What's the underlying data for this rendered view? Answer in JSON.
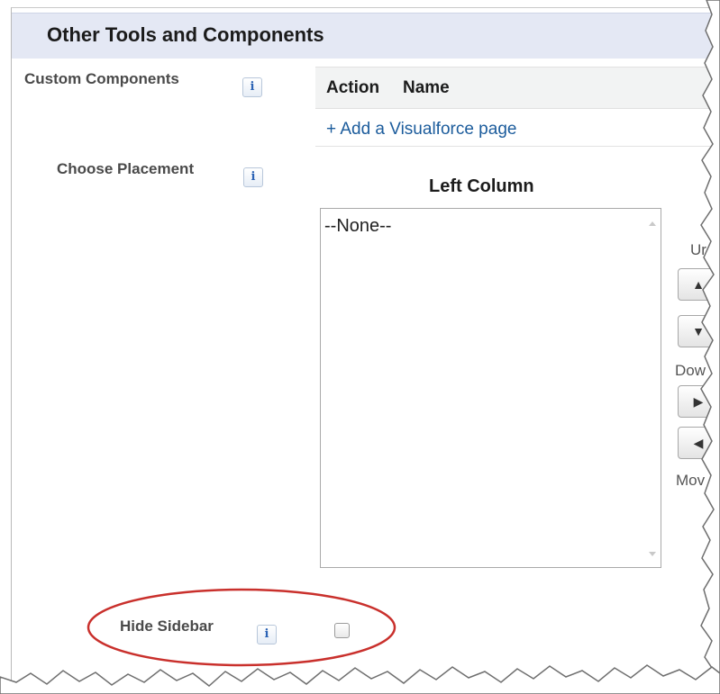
{
  "section": {
    "title": "Other Tools and Components"
  },
  "custom_components": {
    "label": "Custom Components",
    "info_icon": "i",
    "table": {
      "columns": [
        "Action",
        "Name"
      ],
      "add_link": "+ Add a Visualforce page"
    }
  },
  "choose_placement": {
    "label": "Choose Placement",
    "info_icon": "i",
    "left_column": {
      "caption": "Left Column",
      "options": [
        "--None--"
      ]
    },
    "side_controls": {
      "up_label": "Ur",
      "down_label": "Dow",
      "move_label": "Mov",
      "buttons": [
        {
          "icon": "arrow-up-icon",
          "glyph": "▲"
        },
        {
          "icon": "arrow-down-icon",
          "glyph": "▼"
        },
        {
          "icon": "arrow-right-icon",
          "glyph": "▶"
        },
        {
          "icon": "arrow-left-icon",
          "glyph": "◀"
        }
      ]
    }
  },
  "hide_sidebar": {
    "label": "Hide Sidebar",
    "info_icon": "i",
    "checked": false,
    "highlight_color": "#c9302c"
  },
  "colors": {
    "header_bg": "#e4e8f4",
    "link": "#1c5c9c",
    "info_icon": "#2c63b5"
  }
}
